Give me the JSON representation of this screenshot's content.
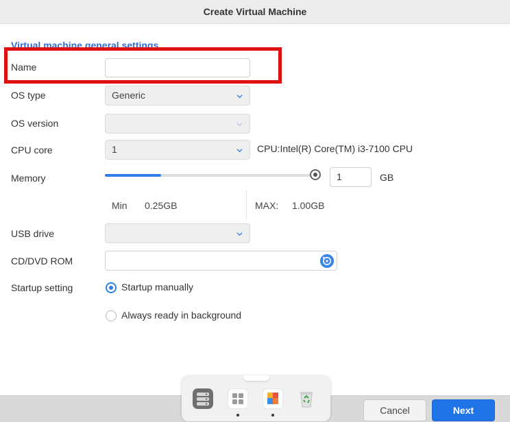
{
  "window": {
    "title": "Create Virtual Machine"
  },
  "section": {
    "title": "Virtual machine general settings"
  },
  "fields": {
    "name": {
      "label": "Name",
      "value": ""
    },
    "os_type": {
      "label": "OS type",
      "value": "Generic"
    },
    "os_version": {
      "label": "OS version",
      "value": ""
    },
    "cpu_core": {
      "label": "CPU core",
      "value": "1",
      "cpu_info": "CPU:Intel(R) Core(TM) i3-7100 CPU"
    },
    "memory": {
      "label": "Memory",
      "value": "1",
      "unit": "GB",
      "slider_fraction": 0.27,
      "min_label": "Min",
      "min_value": "0.25GB",
      "max_label": "MAX:",
      "max_value": "1.00GB"
    },
    "usb_drive": {
      "label": "USB drive",
      "value": ""
    },
    "cd_dvd_rom": {
      "label": "CD/DVD ROM",
      "value": ""
    },
    "startup": {
      "label": "Startup setting",
      "options": [
        {
          "label": "Startup manually",
          "checked": true
        },
        {
          "label": "Always ready in background",
          "checked": false
        }
      ]
    }
  },
  "buttons": {
    "cancel": "Cancel",
    "next": "Next"
  },
  "dock": {
    "apps": [
      "storage-app-icon",
      "app-center-icon",
      "photo-app-icon",
      "recycle-bin-icon"
    ]
  },
  "colors": {
    "accent": "#1f74e8",
    "highlight": "#e01010",
    "section_title": "#2f6fd1"
  }
}
